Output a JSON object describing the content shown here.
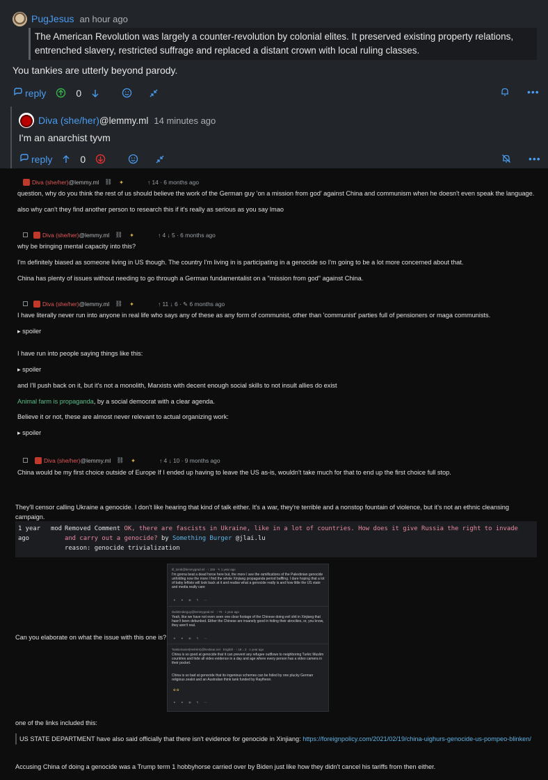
{
  "top_comment": {
    "username": "PugJesus",
    "time": "an hour ago",
    "quote": "The American Revolution was largely a counter-revolution by colonial elites. It preserved existing property relations, entrenched slavery, restricted suffrage and replaced a distant crown with local ruling classes.",
    "body": "You tankies are utterly beyond parody.",
    "reply_label": "reply",
    "score": "0"
  },
  "reply_comment": {
    "username": "Diva (she/her)",
    "instance": "@lemmy.ml",
    "time": "14 minutes ago",
    "body": "I'm an anarchist tyvm",
    "reply_label": "reply",
    "score": "0"
  },
  "screenshot": {
    "c1": {
      "name": "Diva (she/her)",
      "inst": "@lemmy.ml",
      "votes": "↑ 14 · 6 months ago",
      "lines": [
        "question, why do you think the rest of us should believe the work of the German guy 'on a mission from god' against China and communism when he doesn't even speak the language.",
        "also why can't they find another person to research this if it's really as serious as you say lmao"
      ]
    },
    "c2": {
      "name": "Diva (she/her)",
      "inst": "@lemmy.ml",
      "votes": "↑ 4 ↓ 5 · 6 months ago",
      "lines": [
        "why be bringing mental capacity into this?",
        "I'm definitely biased as someone living in US though. The country I'm living in is participating in a genocide so I'm going to be a lot more concerned about that.",
        "China has plenty of issues without needing to go through a German fundamentalist on a \"mission from god\" against China."
      ]
    },
    "c3": {
      "name": "Diva (she/her)",
      "inst": "@lemmy.ml",
      "votes": "↑ 11 ↓ 6 · ✎ 6 months ago",
      "line1": "I have literally never run into anyone in real life who says any of these as any form of communist, other than 'communist' parties full of pensioners or maga communists.",
      "spoiler": "▸ spoiler",
      "line2": "I have run into people saying things like this:",
      "line3": "and I'll push back on it, but it's not a monolith, Marxists with decent enough social skills to not insult allies do exist",
      "link": "Animal farm is propaganda",
      "link_rest": ", by a social democrat with a clear agenda.",
      "line4": "Believe it or not, these are almost never relevant to actual organizing work:"
    },
    "c4": {
      "name": "Diva (she/her)",
      "inst": "@lemmy.ml",
      "votes": "↑ 4 ↓ 10 · 9 months ago",
      "line": "China would be my first choice outside of Europe If I ended up having to leave the US as-is, wouldn't take much for that to end up the first choice full stop."
    },
    "censor_text": "They'll censor calling Ukraine a genocide. I don't like hearing that kind of talk either. It's a war, they're terrible and a nonstop fountain of violence, but it's not an ethnic cleansing campaign.",
    "modlog": {
      "time": "1 year ago",
      "mod": "mod",
      "action": "Removed Comment",
      "text": "OK, there are fascists in Ukraine, like in a lot of countries. How does it give Russia the right to invade and carry out a genocide?",
      "by": "by",
      "community": "Something Burger",
      "community_inst": "@jlai.lu",
      "reason": "reason: genocide trivialization"
    },
    "elaborate": "Can you elaborate on what the issue with this one is?",
    "inner": {
      "h1": "Ill_tomb@lemmygrad.ml · ↑ 155 · ✎ 1 year ago",
      "t1": "I'm gonna beat a dead horse here but, the more I see the ramifications of the Palestinian genocide unfolding now the more I find the whole Xinjiang propaganda period baffling. I dare hoping that a lot of baby leftists will look back at it and realise what a genocide really is and how little the US state and media really care",
      "h2": "DarkEnderguy@lemmygrad.ml · ↑ 70 · 1 year ago",
      "t2": "Yeah, like we have not even seen one clear footage of the Chinese doing evil shit in Xinjiang that hasn't been debunked. Either the Chinese are insanely good in hiding their atrocities, or, you know, they aren't real.",
      "h3": "TankieSoviet(He/Him)@hexbear.net · English · ↑ 18 ↓ 2 · 1 year ago",
      "t3": "China is so good at genocide that it can prevent any refugee outflows to neighboring Turkic Muslim countries and hide all video evidence in a day and age where every person has a video camera in their pocket.",
      "t4": "China is so bad at genocide that its ingenious schemes can be foiled by one plucky German religious zealot and an Australian think tank funded by Raytheon."
    },
    "links_intro": "one of the links included this:",
    "blockquote": "US STATE DEPARTMENT have also said officially that there isn't evidence for genocide in Xinjiang: ",
    "blockquote_link": "https://foreignpolicy.com/2021/02/19/china-uighurs-genocide-us-pompeo-blinken/",
    "final": "Accusing China of doing a genocide was a Trump term 1 hobbyhorse carried over by Biden just like how they didn't cancel his tariffs from then either."
  }
}
